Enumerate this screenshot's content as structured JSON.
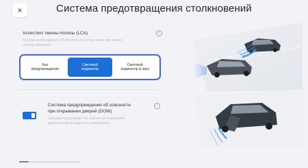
{
  "header": {
    "close_glyph": "×",
    "title": "Система предотвращения столкновений"
  },
  "lca": {
    "title": "Ассистент смены полосы (LCA)",
    "description_line1": "Система информирует об объектах в слепых зонах при смене",
    "description_line2": "полосы движения",
    "options": [
      {
        "line1": "Без",
        "line2": "предупреждения",
        "selected": false
      },
      {
        "line1": "Световой",
        "line2": "индикатор",
        "selected": true
      },
      {
        "line1": "Световой",
        "line2": "индикатор & звук",
        "selected": false
      }
    ]
  },
  "dow": {
    "title_line1": "Система предупреждения об опасности",
    "title_line2": "при открывании дверей (DOW)",
    "description_line1": "Система предупредит об опасности открывания",
    "description_line2": "дверей когда выходите из автомобиля",
    "enabled": true
  },
  "icons": {
    "info": "info-icon",
    "close": "close-icon"
  },
  "colors": {
    "accent": "#1b6fd6",
    "selection_border": "#3f66e6",
    "background": "#f2f3f6",
    "sensor_wave": "#4a8ef0"
  }
}
